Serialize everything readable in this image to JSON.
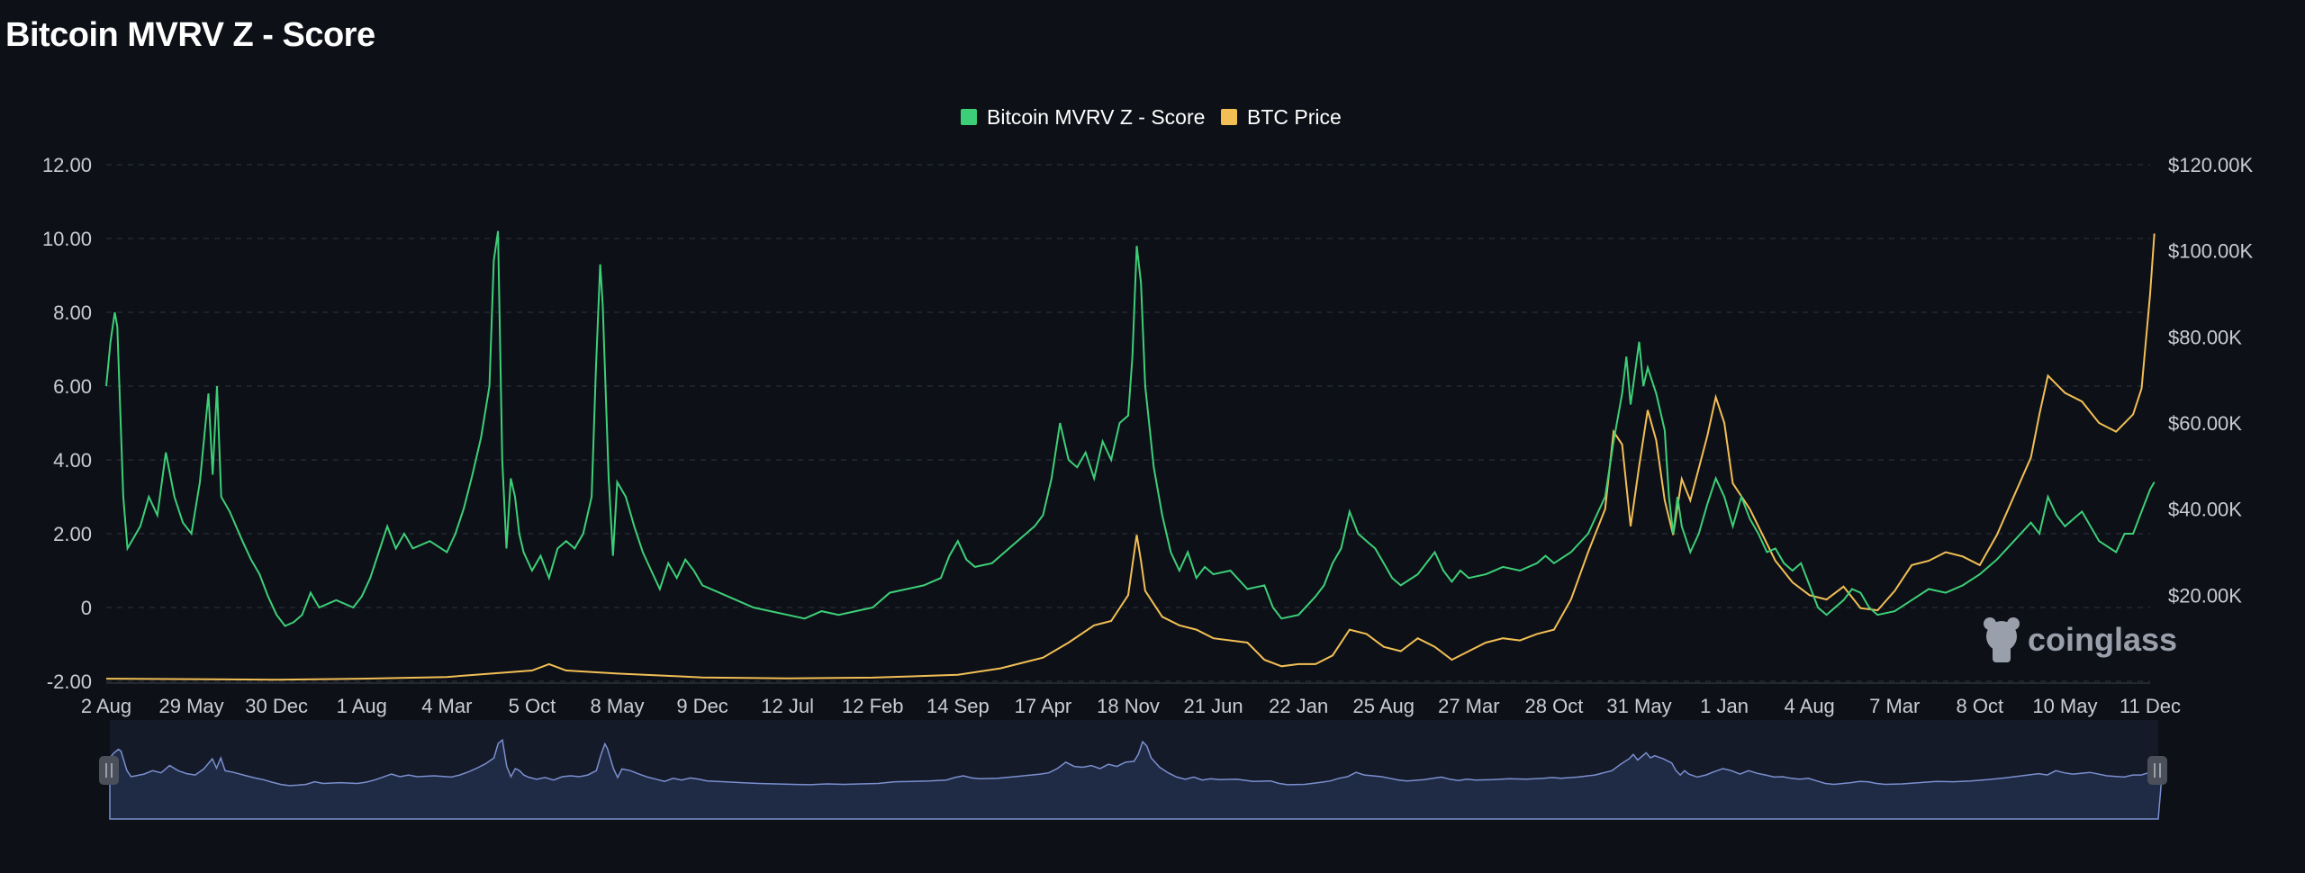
{
  "page": {
    "title": "Bitcoin MVRV Z - Score"
  },
  "watermark": "coinglass",
  "colors": {
    "background": "#0d1017",
    "zscore": "#3dcf78",
    "price": "#f2bf55",
    "grid": "#2e333d",
    "navigator_fill": "#1f2a44",
    "navigator_line": "#7b8fcf",
    "handle": "#4a4f5a"
  },
  "chart_data": {
    "type": "line",
    "title": "Bitcoin MVRV Z - Score",
    "legend": {
      "position": "top-center",
      "items": [
        "Bitcoin MVRV Z - Score",
        "BTC Price"
      ]
    },
    "grid": true,
    "x_tick_labels": [
      "2 Aug",
      "29 May",
      "30 Dec",
      "1 Aug",
      "4 Mar",
      "5 Oct",
      "8 May",
      "9 Dec",
      "12 Jul",
      "12 Feb",
      "14 Sep",
      "17 Apr",
      "18 Nov",
      "21 Jun",
      "22 Jan",
      "25 Aug",
      "27 Mar",
      "28 Oct",
      "31 May",
      "1 Jan",
      "4 Aug",
      "7 Mar",
      "8 Oct",
      "10 May",
      "11 Dec"
    ],
    "y_left": {
      "ticks": [
        "12.00",
        "10.00",
        "8.00",
        "6.00",
        "4.00",
        "2.00",
        "0",
        "-2.00"
      ],
      "range": [
        -2,
        12
      ]
    },
    "y_right": {
      "ticks": [
        "$120.00K",
        "$100.00K",
        "$80.00K",
        "$60.00K",
        "$40.00K",
        "$20.00K"
      ],
      "range": [
        0,
        120000
      ]
    },
    "x_range": [
      0,
      24
    ],
    "series": [
      {
        "name": "Bitcoin MVRV Z - Score",
        "axis": "left",
        "points": [
          [
            0,
            6.0
          ],
          [
            0.05,
            7.2
          ],
          [
            0.1,
            8.0
          ],
          [
            0.13,
            7.6
          ],
          [
            0.2,
            3.0
          ],
          [
            0.25,
            1.6
          ],
          [
            0.4,
            2.2
          ],
          [
            0.5,
            3.0
          ],
          [
            0.6,
            2.5
          ],
          [
            0.7,
            4.2
          ],
          [
            0.8,
            3.0
          ],
          [
            0.9,
            2.3
          ],
          [
            1.0,
            2.0
          ],
          [
            1.1,
            3.4
          ],
          [
            1.2,
            5.8
          ],
          [
            1.25,
            3.6
          ],
          [
            1.3,
            6.0
          ],
          [
            1.35,
            3.0
          ],
          [
            1.45,
            2.6
          ],
          [
            1.6,
            1.8
          ],
          [
            1.7,
            1.3
          ],
          [
            1.8,
            0.9
          ],
          [
            1.9,
            0.3
          ],
          [
            2.0,
            -0.2
          ],
          [
            2.1,
            -0.5
          ],
          [
            2.2,
            -0.4
          ],
          [
            2.3,
            -0.2
          ],
          [
            2.4,
            0.4
          ],
          [
            2.5,
            0.0
          ],
          [
            2.7,
            0.2
          ],
          [
            2.9,
            0.0
          ],
          [
            3.0,
            0.3
          ],
          [
            3.1,
            0.8
          ],
          [
            3.2,
            1.5
          ],
          [
            3.3,
            2.2
          ],
          [
            3.4,
            1.6
          ],
          [
            3.5,
            2.0
          ],
          [
            3.6,
            1.6
          ],
          [
            3.8,
            1.8
          ],
          [
            4.0,
            1.5
          ],
          [
            4.1,
            2.0
          ],
          [
            4.2,
            2.7
          ],
          [
            4.3,
            3.6
          ],
          [
            4.4,
            4.6
          ],
          [
            4.5,
            6.0
          ],
          [
            4.55,
            9.4
          ],
          [
            4.6,
            10.2
          ],
          [
            4.65,
            4.0
          ],
          [
            4.7,
            1.6
          ],
          [
            4.75,
            3.5
          ],
          [
            4.8,
            3.0
          ],
          [
            4.85,
            2.0
          ],
          [
            4.9,
            1.5
          ],
          [
            5.0,
            1.0
          ],
          [
            5.1,
            1.4
          ],
          [
            5.2,
            0.8
          ],
          [
            5.3,
            1.6
          ],
          [
            5.4,
            1.8
          ],
          [
            5.5,
            1.6
          ],
          [
            5.6,
            2.0
          ],
          [
            5.7,
            3.0
          ],
          [
            5.75,
            6.5
          ],
          [
            5.8,
            9.3
          ],
          [
            5.83,
            8.2
          ],
          [
            5.9,
            3.5
          ],
          [
            5.95,
            1.4
          ],
          [
            6.0,
            3.4
          ],
          [
            6.1,
            3.0
          ],
          [
            6.2,
            2.2
          ],
          [
            6.3,
            1.5
          ],
          [
            6.4,
            1.0
          ],
          [
            6.5,
            0.5
          ],
          [
            6.6,
            1.2
          ],
          [
            6.7,
            0.8
          ],
          [
            6.8,
            1.3
          ],
          [
            6.9,
            1.0
          ],
          [
            7.0,
            0.6
          ],
          [
            7.2,
            0.4
          ],
          [
            7.4,
            0.2
          ],
          [
            7.6,
            0.0
          ],
          [
            7.8,
            -0.1
          ],
          [
            8.0,
            -0.2
          ],
          [
            8.2,
            -0.3
          ],
          [
            8.4,
            -0.1
          ],
          [
            8.6,
            -0.2
          ],
          [
            8.8,
            -0.1
          ],
          [
            9.0,
            0.0
          ],
          [
            9.2,
            0.4
          ],
          [
            9.4,
            0.5
          ],
          [
            9.6,
            0.6
          ],
          [
            9.8,
            0.8
          ],
          [
            9.9,
            1.4
          ],
          [
            10.0,
            1.8
          ],
          [
            10.1,
            1.3
          ],
          [
            10.2,
            1.1
          ],
          [
            10.4,
            1.2
          ],
          [
            10.6,
            1.6
          ],
          [
            10.8,
            2.0
          ],
          [
            10.9,
            2.2
          ],
          [
            11.0,
            2.5
          ],
          [
            11.1,
            3.5
          ],
          [
            11.2,
            5.0
          ],
          [
            11.3,
            4.0
          ],
          [
            11.4,
            3.8
          ],
          [
            11.5,
            4.2
          ],
          [
            11.6,
            3.5
          ],
          [
            11.7,
            4.5
          ],
          [
            11.8,
            4.0
          ],
          [
            11.9,
            5.0
          ],
          [
            12.0,
            5.2
          ],
          [
            12.05,
            6.8
          ],
          [
            12.1,
            9.8
          ],
          [
            12.15,
            8.8
          ],
          [
            12.2,
            6.0
          ],
          [
            12.3,
            3.8
          ],
          [
            12.4,
            2.5
          ],
          [
            12.5,
            1.5
          ],
          [
            12.6,
            1.0
          ],
          [
            12.7,
            1.5
          ],
          [
            12.8,
            0.8
          ],
          [
            12.9,
            1.1
          ],
          [
            13.0,
            0.9
          ],
          [
            13.2,
            1.0
          ],
          [
            13.4,
            0.5
          ],
          [
            13.6,
            0.6
          ],
          [
            13.7,
            0.0
          ],
          [
            13.8,
            -0.3
          ],
          [
            14.0,
            -0.2
          ],
          [
            14.2,
            0.3
          ],
          [
            14.3,
            0.6
          ],
          [
            14.4,
            1.2
          ],
          [
            14.5,
            1.6
          ],
          [
            14.6,
            2.6
          ],
          [
            14.7,
            2.0
          ],
          [
            14.8,
            1.8
          ],
          [
            14.9,
            1.6
          ],
          [
            15.0,
            1.2
          ],
          [
            15.1,
            0.8
          ],
          [
            15.2,
            0.6
          ],
          [
            15.4,
            0.9
          ],
          [
            15.6,
            1.5
          ],
          [
            15.7,
            1.0
          ],
          [
            15.8,
            0.7
          ],
          [
            15.9,
            1.0
          ],
          [
            16.0,
            0.8
          ],
          [
            16.2,
            0.9
          ],
          [
            16.4,
            1.1
          ],
          [
            16.6,
            1.0
          ],
          [
            16.8,
            1.2
          ],
          [
            16.9,
            1.4
          ],
          [
            17.0,
            1.2
          ],
          [
            17.2,
            1.5
          ],
          [
            17.4,
            2.0
          ],
          [
            17.5,
            2.5
          ],
          [
            17.6,
            3.0
          ],
          [
            17.7,
            4.5
          ],
          [
            17.8,
            5.8
          ],
          [
            17.85,
            6.8
          ],
          [
            17.9,
            5.5
          ],
          [
            18.0,
            7.2
          ],
          [
            18.05,
            6.0
          ],
          [
            18.1,
            6.5
          ],
          [
            18.2,
            5.8
          ],
          [
            18.3,
            4.8
          ],
          [
            18.35,
            3.0
          ],
          [
            18.4,
            2.0
          ],
          [
            18.45,
            3.0
          ],
          [
            18.5,
            2.2
          ],
          [
            18.6,
            1.5
          ],
          [
            18.7,
            2.0
          ],
          [
            18.8,
            2.8
          ],
          [
            18.9,
            3.5
          ],
          [
            19.0,
            3.0
          ],
          [
            19.1,
            2.2
          ],
          [
            19.2,
            3.0
          ],
          [
            19.3,
            2.4
          ],
          [
            19.4,
            2.0
          ],
          [
            19.5,
            1.5
          ],
          [
            19.6,
            1.6
          ],
          [
            19.7,
            1.2
          ],
          [
            19.8,
            1.0
          ],
          [
            19.9,
            1.2
          ],
          [
            20.0,
            0.6
          ],
          [
            20.1,
            0.0
          ],
          [
            20.2,
            -0.2
          ],
          [
            20.4,
            0.2
          ],
          [
            20.5,
            0.5
          ],
          [
            20.6,
            0.4
          ],
          [
            20.7,
            0.0
          ],
          [
            20.8,
            -0.2
          ],
          [
            21.0,
            -0.1
          ],
          [
            21.2,
            0.2
          ],
          [
            21.4,
            0.5
          ],
          [
            21.6,
            0.4
          ],
          [
            21.8,
            0.6
          ],
          [
            22.0,
            0.9
          ],
          [
            22.2,
            1.3
          ],
          [
            22.4,
            1.8
          ],
          [
            22.6,
            2.3
          ],
          [
            22.7,
            2.0
          ],
          [
            22.8,
            3.0
          ],
          [
            22.9,
            2.5
          ],
          [
            23.0,
            2.2
          ],
          [
            23.2,
            2.6
          ],
          [
            23.4,
            1.8
          ],
          [
            23.6,
            1.5
          ],
          [
            23.7,
            2.0
          ],
          [
            23.8,
            2.0
          ],
          [
            23.9,
            2.6
          ],
          [
            24.0,
            3.2
          ],
          [
            24.05,
            3.4
          ]
        ]
      },
      {
        "name": "BTC Price",
        "axis": "right",
        "points": [
          [
            0,
            600
          ],
          [
            1,
            500
          ],
          [
            2,
            350
          ],
          [
            3,
            600
          ],
          [
            4,
            1000
          ],
          [
            5,
            2500
          ],
          [
            5.2,
            4000
          ],
          [
            5.4,
            2500
          ],
          [
            6,
            1800
          ],
          [
            7,
            900
          ],
          [
            8,
            700
          ],
          [
            9,
            850
          ],
          [
            10,
            1500
          ],
          [
            10.5,
            3000
          ],
          [
            11,
            5500
          ],
          [
            11.3,
            9000
          ],
          [
            11.6,
            13000
          ],
          [
            11.8,
            14000
          ],
          [
            12.0,
            20000
          ],
          [
            12.05,
            27000
          ],
          [
            12.1,
            34000
          ],
          [
            12.15,
            28000
          ],
          [
            12.2,
            21000
          ],
          [
            12.4,
            15000
          ],
          [
            12.6,
            13000
          ],
          [
            12.8,
            12000
          ],
          [
            13.0,
            10000
          ],
          [
            13.4,
            9000
          ],
          [
            13.6,
            5000
          ],
          [
            13.8,
            3500
          ],
          [
            14.0,
            4000
          ],
          [
            14.2,
            4000
          ],
          [
            14.4,
            6000
          ],
          [
            14.6,
            12000
          ],
          [
            14.8,
            11000
          ],
          [
            15.0,
            8000
          ],
          [
            15.2,
            7000
          ],
          [
            15.4,
            10000
          ],
          [
            15.6,
            8000
          ],
          [
            15.8,
            5000
          ],
          [
            16.0,
            7000
          ],
          [
            16.2,
            9000
          ],
          [
            16.4,
            10000
          ],
          [
            16.6,
            9500
          ],
          [
            16.8,
            11000
          ],
          [
            17.0,
            12000
          ],
          [
            17.2,
            19000
          ],
          [
            17.4,
            30000
          ],
          [
            17.6,
            40000
          ],
          [
            17.7,
            58000
          ],
          [
            17.8,
            55000
          ],
          [
            17.9,
            36000
          ],
          [
            18.0,
            50000
          ],
          [
            18.1,
            63000
          ],
          [
            18.2,
            56000
          ],
          [
            18.3,
            42000
          ],
          [
            18.4,
            34000
          ],
          [
            18.5,
            47000
          ],
          [
            18.6,
            42000
          ],
          [
            18.8,
            57000
          ],
          [
            18.9,
            66000
          ],
          [
            19.0,
            60000
          ],
          [
            19.1,
            46000
          ],
          [
            19.3,
            40000
          ],
          [
            19.4,
            36000
          ],
          [
            19.6,
            28000
          ],
          [
            19.8,
            23000
          ],
          [
            20.0,
            20000
          ],
          [
            20.2,
            19000
          ],
          [
            20.4,
            22000
          ],
          [
            20.6,
            17000
          ],
          [
            20.8,
            16500
          ],
          [
            21.0,
            21000
          ],
          [
            21.2,
            27000
          ],
          [
            21.4,
            28000
          ],
          [
            21.6,
            30000
          ],
          [
            21.8,
            29000
          ],
          [
            22.0,
            27000
          ],
          [
            22.2,
            34000
          ],
          [
            22.4,
            43000
          ],
          [
            22.6,
            52000
          ],
          [
            22.7,
            62000
          ],
          [
            22.8,
            71000
          ],
          [
            23.0,
            67000
          ],
          [
            23.2,
            65000
          ],
          [
            23.4,
            60000
          ],
          [
            23.6,
            58000
          ],
          [
            23.8,
            62000
          ],
          [
            23.9,
            68000
          ],
          [
            24.0,
            90000
          ],
          [
            24.05,
            104000
          ]
        ]
      }
    ]
  }
}
